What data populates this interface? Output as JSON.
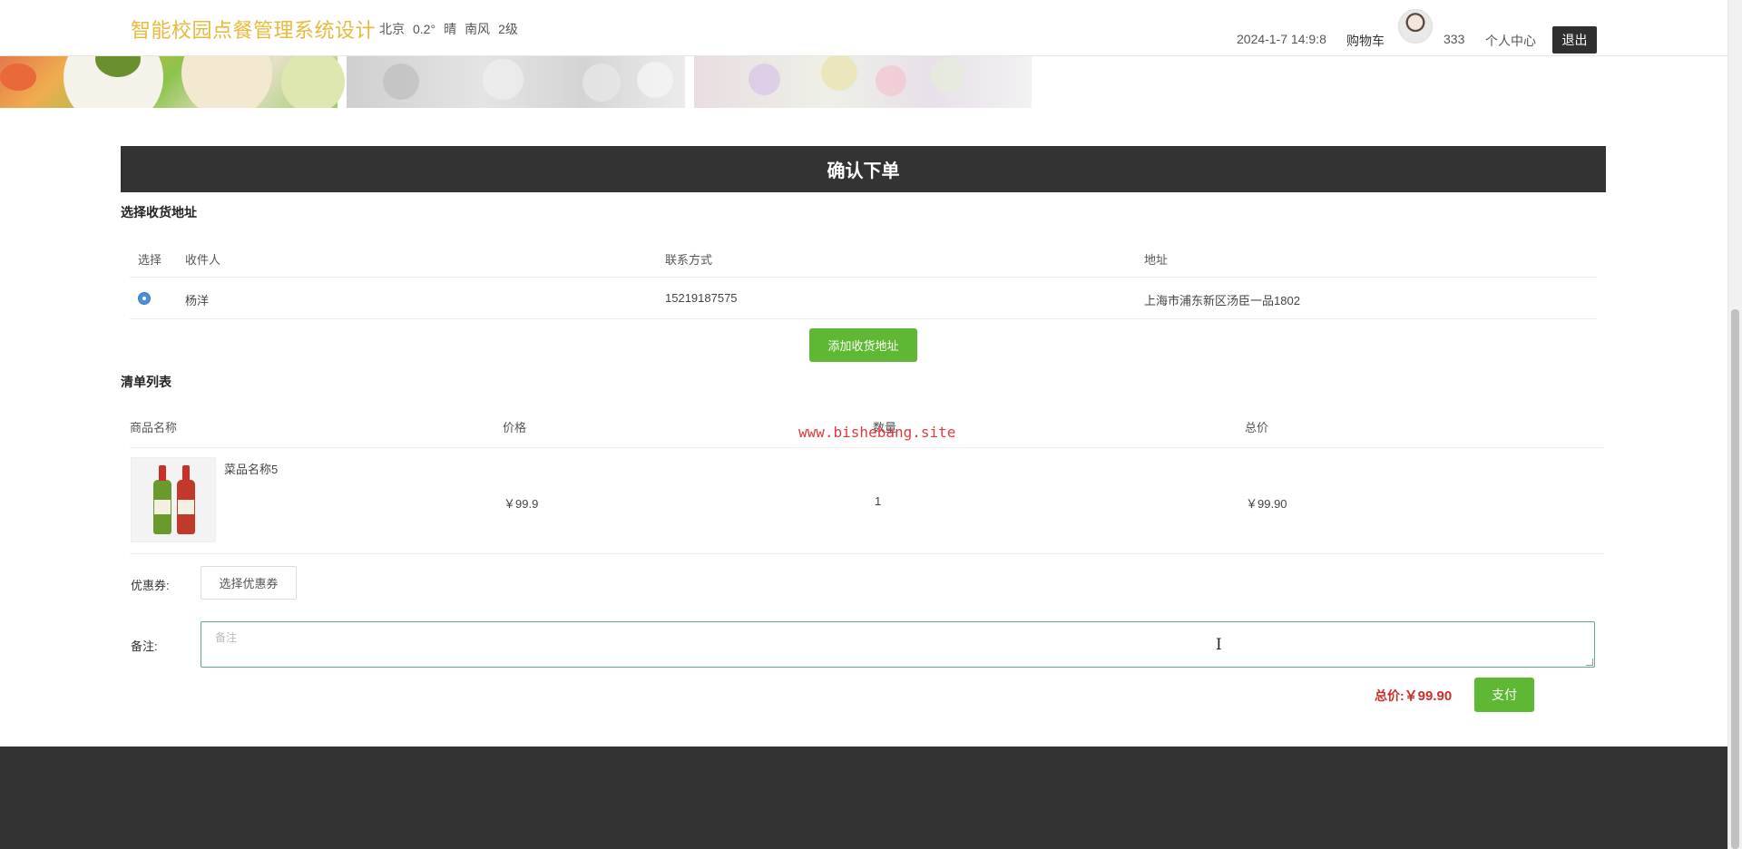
{
  "header": {
    "site_title": "智能校园点餐管理系统设计",
    "weather": {
      "city": "北京",
      "temp": "0.2°",
      "condition": "晴",
      "wind_dir": "南风",
      "wind_level": "2级"
    },
    "datetime": "2024-1-7 14:9:8",
    "cart": "购物车",
    "username": "333",
    "user_center": "个人中心",
    "logout": "退出"
  },
  "confirm_title": "确认下单",
  "address_section": {
    "title": "选择收货地址",
    "columns": [
      "选择",
      "收件人",
      "联系方式",
      "地址"
    ],
    "rows": [
      {
        "selected": true,
        "name": "杨洋",
        "phone": "15219187575",
        "address": "上海市浦东新区汤臣一品1802"
      }
    ],
    "add_button": "添加收货地址"
  },
  "order_section": {
    "title": "清单列表",
    "columns": [
      "商品名称",
      "价格",
      "数量",
      "总价"
    ],
    "rows": [
      {
        "name": "菜品名称5",
        "price": "￥99.9",
        "quantity": "1",
        "total": "￥99.90"
      }
    ]
  },
  "watermark": "www.bishebang.site",
  "coupon": {
    "label": "优惠券:",
    "button": "选择优惠券"
  },
  "remark": {
    "label": "备注:",
    "placeholder": "备注"
  },
  "summary": {
    "total_label": "总价:",
    "total_value": "￥99.90",
    "pay_button": "支付"
  },
  "colors": {
    "accent_green": "#5fb833",
    "title_gold": "#e8b93b",
    "dark_bar": "#333333",
    "price_red": "#c9302c"
  }
}
